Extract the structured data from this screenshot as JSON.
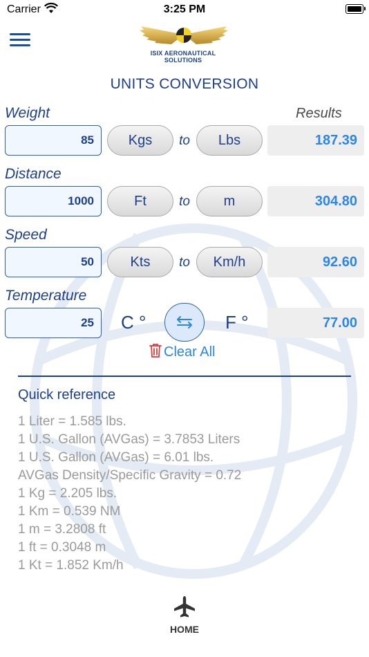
{
  "status_bar": {
    "carrier": "Carrier",
    "time": "3:25 PM"
  },
  "header": {
    "logo_text": "ISIX  AERONAUTICAL SOLUTIONS",
    "title": "UNITS CONVERSION"
  },
  "results_label": "Results",
  "rows": {
    "weight": {
      "label": "Weight",
      "input": "85",
      "from": "Kgs",
      "to_word": "to",
      "to": "Lbs",
      "result": "187.39"
    },
    "distance": {
      "label": "Distance",
      "input": "1000",
      "from": "Ft",
      "to_word": "to",
      "to": "m",
      "result": "304.80"
    },
    "speed": {
      "label": "Speed",
      "input": "50",
      "from": "Kts",
      "to_word": "to",
      "to": "Km/h",
      "result": "92.60"
    },
    "temperature": {
      "label": "Temperature",
      "input": "25",
      "from": "C °",
      "to": "F °",
      "result": "77.00"
    }
  },
  "clear_all": "Clear All",
  "quick_reference": {
    "title": "Quick reference",
    "items": [
      "1  Liter = 1.585 lbs.",
      "1  U.S. Gallon (AVGas) = 3.7853 Liters",
      "1  U.S. Gallon (AVGas) = 6.01 lbs.",
      "AVGas Density/Specific Gravity = 0.72",
      "1  Kg = 2.205 lbs.",
      "1  Km = 0.539 NM",
      "1  m = 3.2808 ft",
      "1  ft = 0.3048 m",
      "1  Kt = 1.852 Km/h"
    ]
  },
  "tabbar": {
    "home_label": "HOME"
  },
  "colors": {
    "primary": "#1d3f8a",
    "accent": "#2b86e6",
    "clear": "#e03a3a"
  }
}
